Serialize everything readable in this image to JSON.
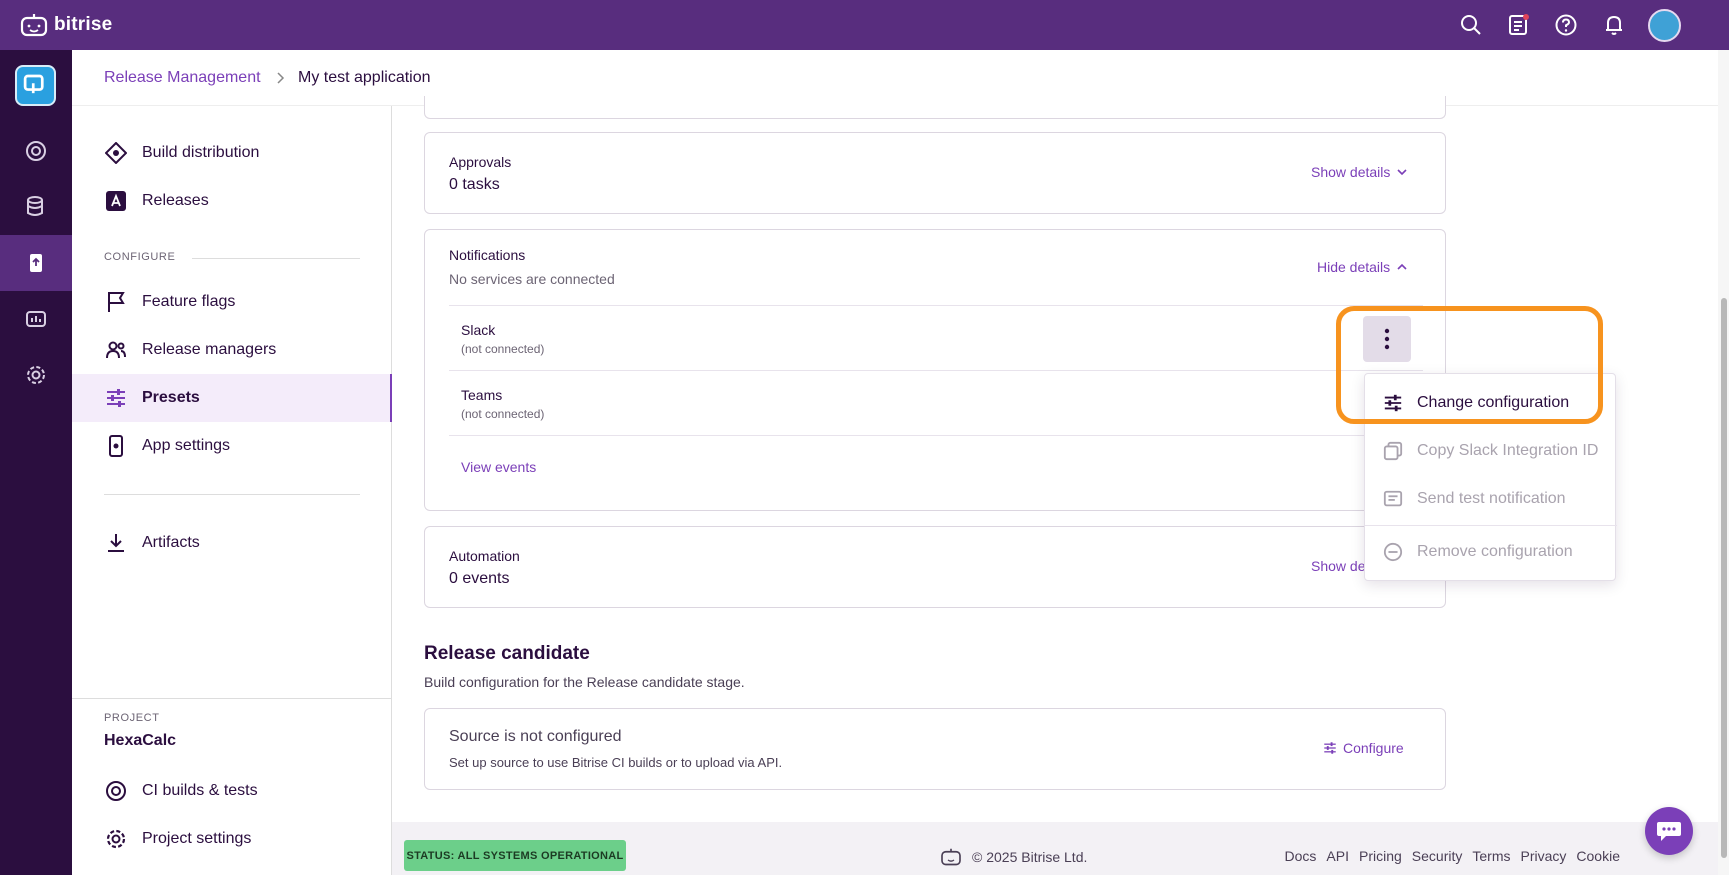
{
  "app": {
    "brand": "bitrise"
  },
  "breadcrumb": {
    "parent": "Release Management",
    "current": "My test application"
  },
  "sidebar": {
    "items_top": [
      {
        "label": "Build distribution",
        "icon": "build-distribution-icon"
      },
      {
        "label": "Releases",
        "icon": "app-store-icon"
      }
    ],
    "configure_label": "CONFIGURE",
    "items_configure": [
      {
        "label": "Feature flags",
        "icon": "flag-icon"
      },
      {
        "label": "Release managers",
        "icon": "users-icon"
      },
      {
        "label": "Presets",
        "icon": "sliders-icon",
        "active": true
      },
      {
        "label": "App settings",
        "icon": "app-settings-icon"
      }
    ],
    "artifacts": {
      "label": "Artifacts",
      "icon": "download-icon"
    },
    "project_label": "PROJECT",
    "project_name": "HexaCalc",
    "project_items": [
      {
        "label": "CI builds & tests",
        "icon": "ci-builds-icon"
      },
      {
        "label": "Project settings",
        "icon": "gear-icon"
      }
    ]
  },
  "approvals": {
    "title": "Approvals",
    "value": "0 tasks",
    "link": "Show details"
  },
  "notifications": {
    "title": "Notifications",
    "subtitle": "No services are connected",
    "link": "Hide details",
    "services": [
      {
        "name": "Slack",
        "status": "(not connected)"
      },
      {
        "name": "Teams",
        "status": "(not connected)"
      }
    ],
    "view_events": "View events"
  },
  "automation": {
    "title": "Automation",
    "value": "0 events",
    "link": "Show de"
  },
  "release_candidate": {
    "title": "Release candidate",
    "subtitle": "Build configuration for the Release candidate stage.",
    "source_title": "Source is not configured",
    "source_sub": "Set up source to use Bitrise CI builds or to upload via API.",
    "configure": "Configure"
  },
  "menu": {
    "items": [
      {
        "label": "Change configuration",
        "icon": "sliders-icon",
        "enabled": true
      },
      {
        "label": "Copy Slack Integration ID",
        "icon": "copy-icon",
        "enabled": false
      },
      {
        "label": "Send test notification",
        "icon": "message-icon",
        "enabled": false
      },
      {
        "label": "Remove configuration",
        "icon": "minus-circle-icon",
        "enabled": false
      }
    ]
  },
  "footer": {
    "status": "STATUS: ALL SYSTEMS OPERATIONAL",
    "copyright": "© 2025 Bitrise Ltd.",
    "links": [
      "Docs",
      "API",
      "Pricing",
      "Security",
      "Terms",
      "Privacy",
      "Cookie"
    ]
  },
  "colors": {
    "brand": "#582d7e",
    "accent": "#7b3fb8",
    "highlight": "#f7931e",
    "status_ok": "#6ccf8a"
  }
}
